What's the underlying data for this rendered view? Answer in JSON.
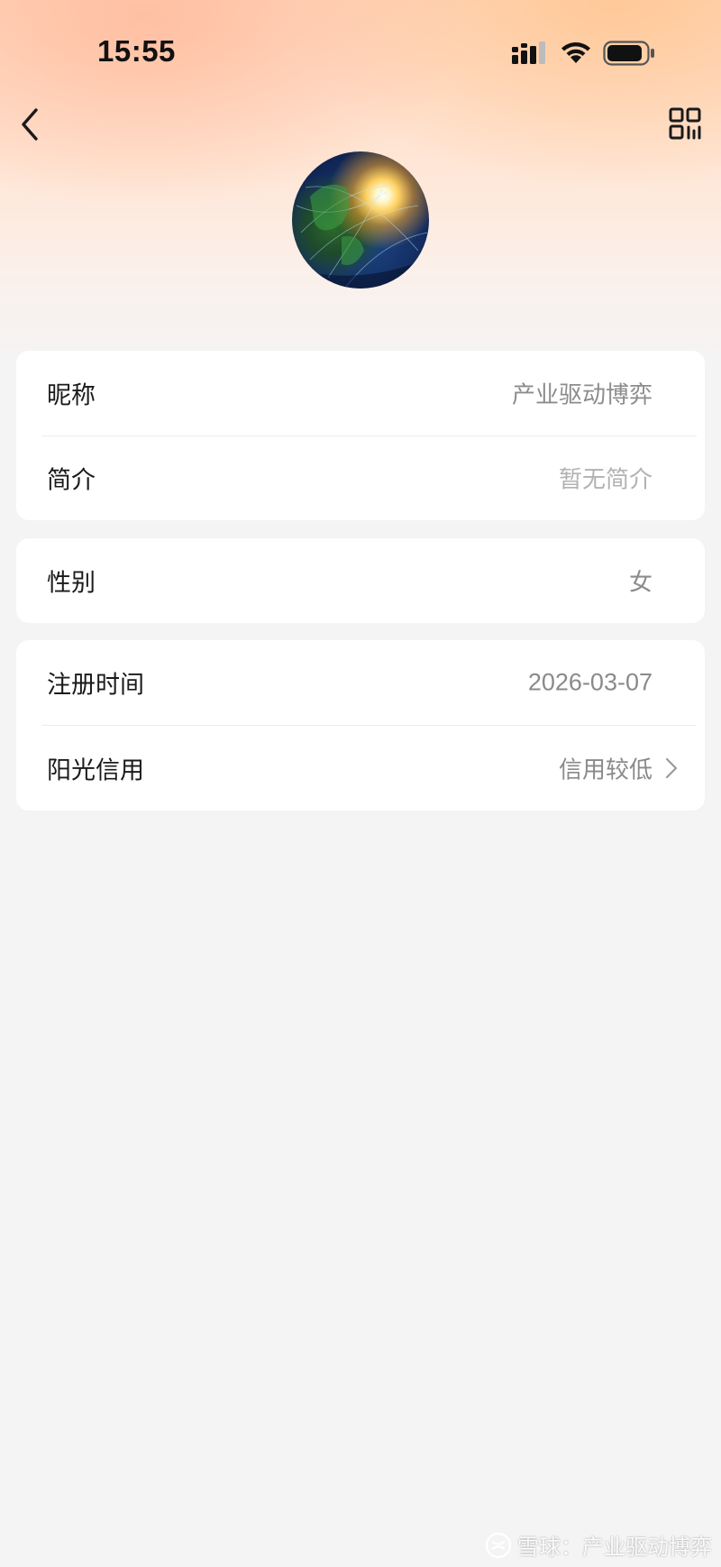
{
  "status_bar": {
    "time": "15:55",
    "icons": [
      "signal-icon",
      "wifi-icon",
      "battery-icon"
    ]
  },
  "nav": {
    "back_icon": "back-icon",
    "qr_icon": "qr-code-icon"
  },
  "profile": {
    "avatar": "earth-globe-avatar"
  },
  "info_groups": [
    {
      "rows": [
        {
          "label": "昵称",
          "value": "产业驱动博弈"
        },
        {
          "label": "简介",
          "value": "暂无简介"
        }
      ]
    },
    {
      "rows": [
        {
          "label": "性别",
          "value": "女"
        }
      ]
    },
    {
      "rows": [
        {
          "label": "注册时间",
          "value": "2026-03-07"
        },
        {
          "label": "阳光信用",
          "value": "信用较低",
          "chevron": "chevron-right-icon"
        }
      ]
    }
  ],
  "watermark": {
    "text": "雪球：产业驱动博弈",
    "icon": "snowball-logo-icon"
  },
  "colors": {
    "page_background": "#f4f4f4",
    "card_background": "#ffffff",
    "label_text": "#1a1a1a",
    "value_text": "#8c8c8c",
    "header_gradient_top": "#ffd8c0"
  }
}
